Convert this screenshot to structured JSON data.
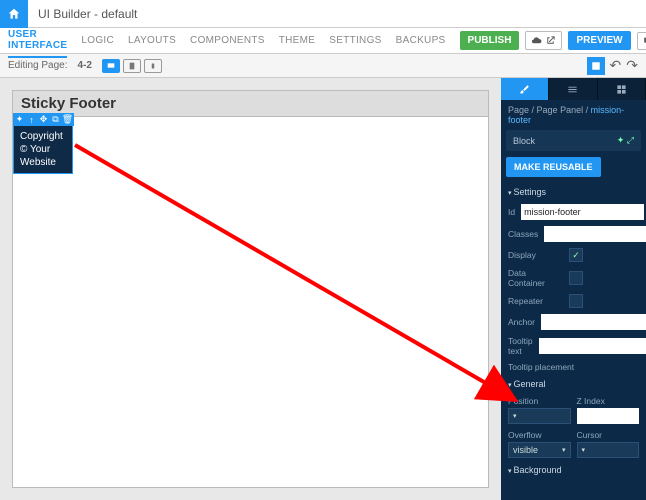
{
  "app": {
    "title": "UI Builder - default"
  },
  "tabs": [
    "USER INTERFACE",
    "LOGIC",
    "LAYOUTS",
    "COMPONENTS",
    "THEME",
    "SETTINGS",
    "BACKUPS"
  ],
  "publish": "PUBLISH",
  "preview": "PREVIEW",
  "editing": {
    "label": "Editing Page:",
    "page": "4-2"
  },
  "canvas": {
    "header": "Sticky Footer",
    "selected_text": "Copyright © Your Website"
  },
  "panel": {
    "breadcrumb": {
      "a": "Page",
      "b": "Page Panel",
      "c": "mission-footer"
    },
    "block": "Block",
    "reusable": "MAKE REUSABLE",
    "settings": {
      "title": "Settings",
      "id_label": "Id",
      "id_value": "mission-footer",
      "classes_label": "Classes",
      "display_label": "Display",
      "data_container_label": "Data Container",
      "repeater_label": "Repeater",
      "anchor_label": "Anchor",
      "tooltip_label": "Tooltip text",
      "tooltip_placement_label": "Tooltip placement"
    },
    "general": {
      "title": "General",
      "position_label": "Position",
      "zindex_label": "Z Index",
      "overflow_label": "Overflow",
      "overflow_value": "visible",
      "cursor_label": "Cursor"
    },
    "background": {
      "title": "Background"
    }
  }
}
